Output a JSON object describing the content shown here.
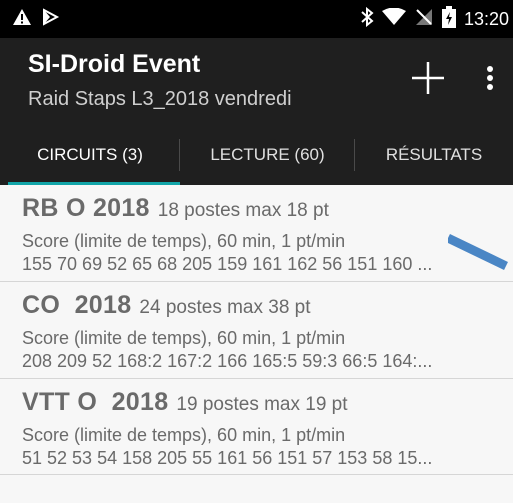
{
  "status_bar": {
    "time": "13:20",
    "icons": [
      "warning-icon",
      "play-icon",
      "bluetooth-icon",
      "wifi-icon",
      "no-signal-icon",
      "battery-charging-icon"
    ]
  },
  "app_bar": {
    "title": "SI-Droid Event",
    "subtitle": "Raid Staps L3_2018 vendredi",
    "actions": [
      "add-icon",
      "more-vert-icon"
    ]
  },
  "tabs": [
    {
      "label": "CIRCUITS (3)",
      "selected": true
    },
    {
      "label": "LECTURE (60)",
      "selected": false
    },
    {
      "label": "RÉSULTATS",
      "selected": false
    }
  ],
  "circuits": [
    {
      "name": "RB O 2018",
      "summary": "18 postes max 18 pt",
      "rules": "Score (limite de temps), 60 min, 1 pt/min",
      "controls": "155 70 69 52 65 68 205 159 161 162 56 151 160 ..."
    },
    {
      "name": "CO  2018",
      "summary": "24 postes max 38 pt",
      "rules": "Score (limite de temps), 60 min, 1 pt/min",
      "controls": "208 209 52 168:2 167:2 166 165:5 59:3 66:5 164:..."
    },
    {
      "name": "VTT O  2018",
      "summary": "19 postes max 19 pt",
      "rules": "Score (limite de temps), 60 min, 1 pt/min",
      "controls": "51 52 53 54 158 205 55 161 56 151 57 153 58 15..."
    }
  ],
  "colors": {
    "accent": "#12a5a8",
    "app_bar": "#1f1f1f",
    "annotation_arrow": "#4a86c5"
  }
}
